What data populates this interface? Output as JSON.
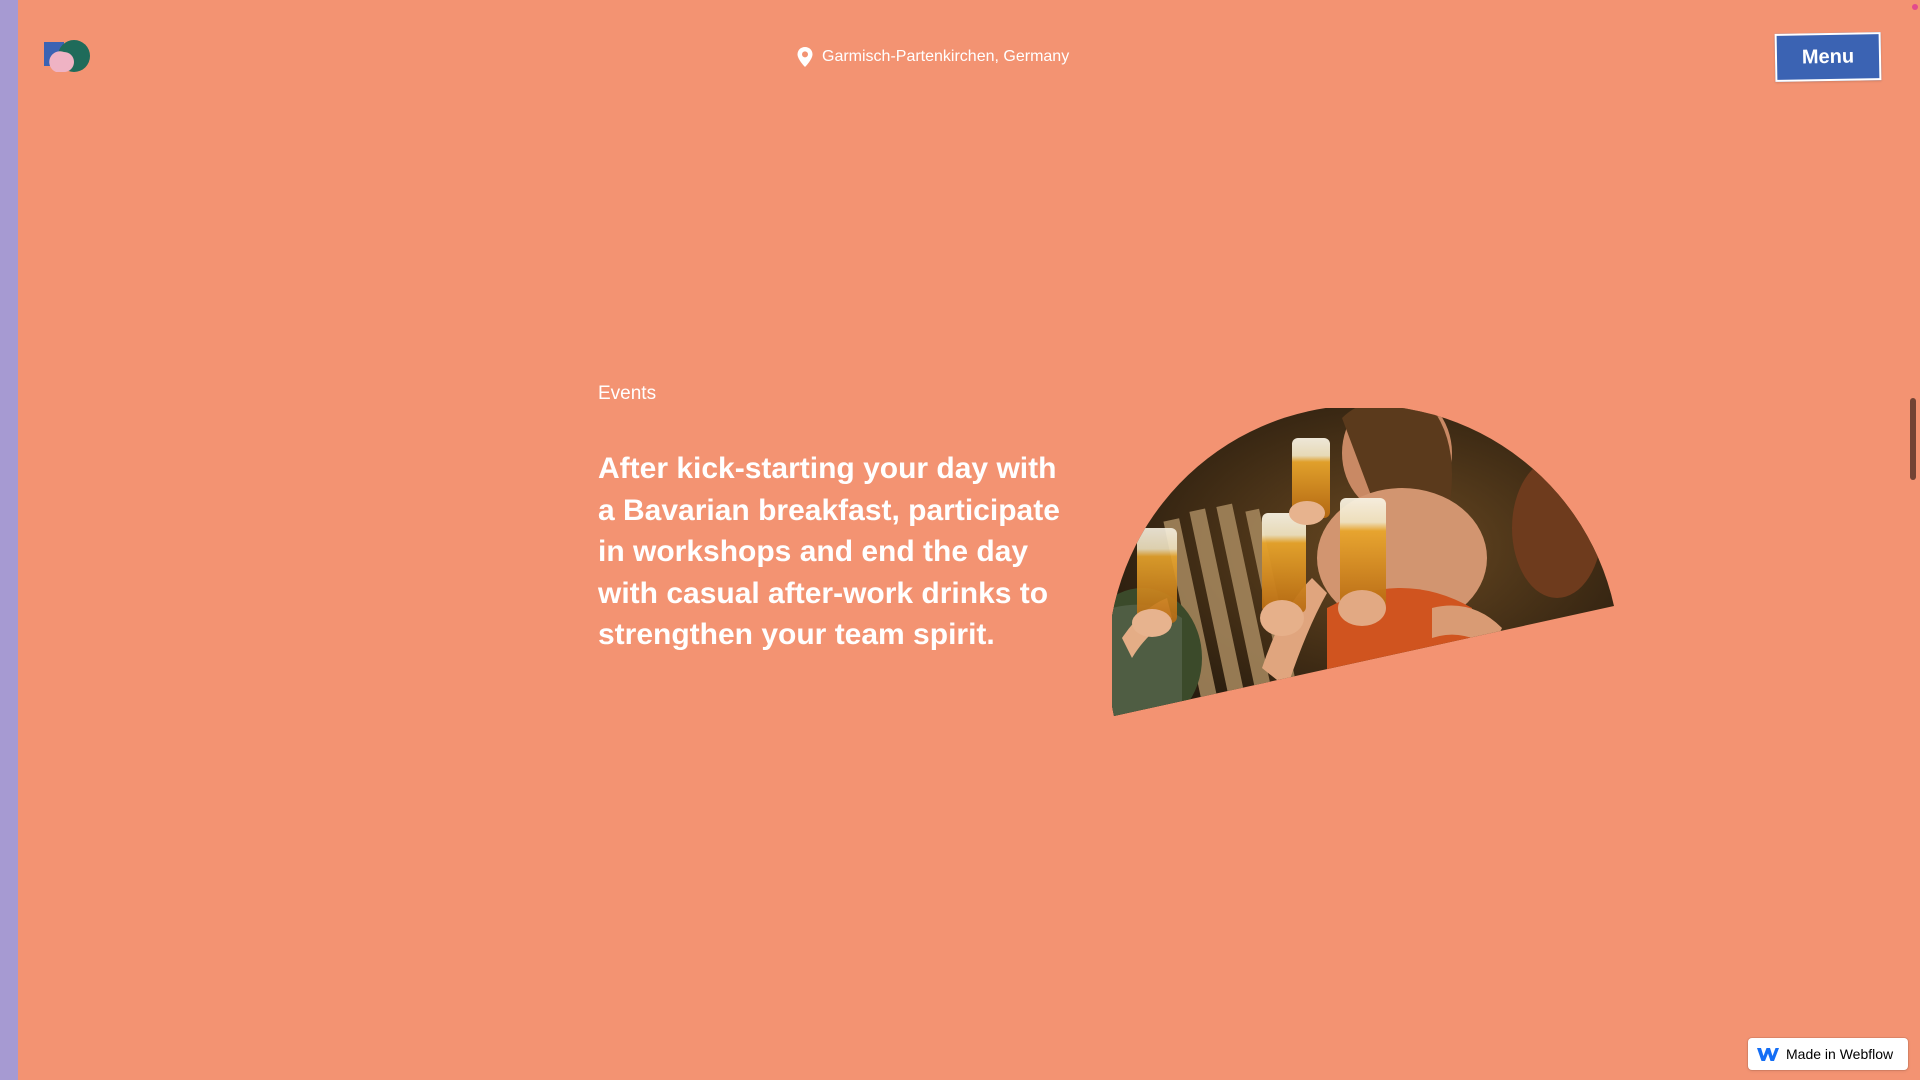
{
  "colors": {
    "page_bg": "#f39372",
    "left_strip": "#a69ad2",
    "menu_bg": "#3b63b3",
    "logo_blue": "#3b63b3",
    "logo_teal": "#1f6b5a",
    "logo_pink": "#efb3c4",
    "webflow_blue": "#146ef5"
  },
  "header": {
    "logo_icon": "brand-logo",
    "location_icon": "map-pin-icon",
    "location": "Garmisch-Partenkirchen, Germany",
    "menu_label": "Menu"
  },
  "section": {
    "eyebrow": "Events",
    "headline": "After kick-starting your day with a Bavarian breakfast, participate in workshops and end the day with casual after-work drinks to strengthen your team spirit.",
    "image_icon": "people-toasting-beer-photo"
  },
  "badge": {
    "icon": "webflow-logo-icon",
    "label": "Made in Webflow"
  }
}
